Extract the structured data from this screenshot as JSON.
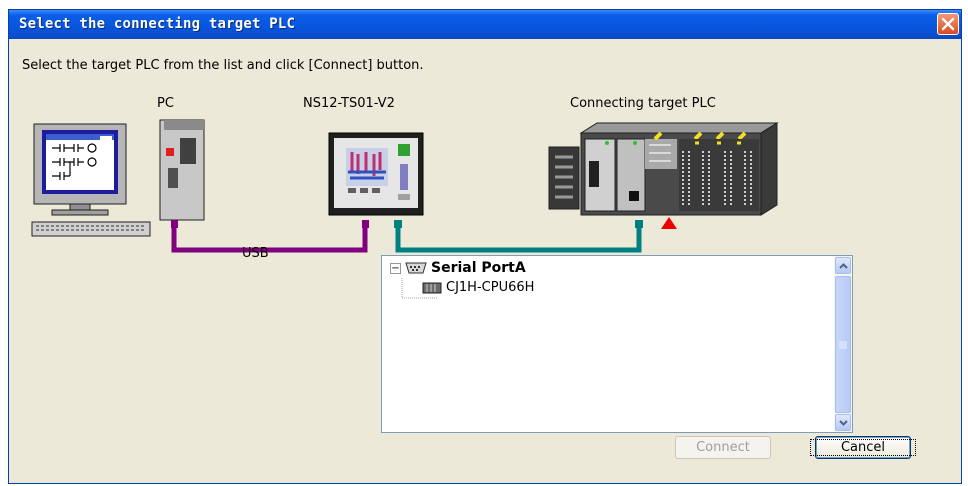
{
  "window": {
    "title": "Select the connecting target PLC",
    "close_icon": "close-icon"
  },
  "instruction": "Select the target PLC from the list and click [Connect] button.",
  "diagram": {
    "pc_label": "PC",
    "terminal_label": "NS12-TS01-V2",
    "plc_label": "Connecting target PLC",
    "usb_label": "USB",
    "usb_line_color": "#800080",
    "serial_line_color": "#008080",
    "marker_color": "#ee0000"
  },
  "tree": {
    "port_label": "Serial PortA",
    "device_label": "CJ1H-CPU66H",
    "expanded_glyph": "−"
  },
  "buttons": {
    "connect_label": "Connect",
    "cancel_label": "Cancel"
  }
}
